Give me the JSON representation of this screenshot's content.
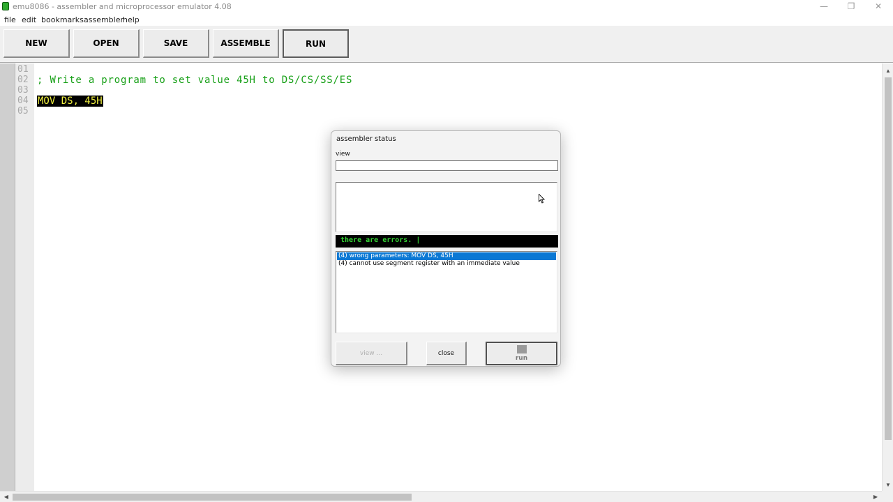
{
  "window": {
    "title": "emu8086 - assembler and microprocessor emulator 4.08",
    "controls": {
      "minimize": "—",
      "maximize": "❐",
      "close": "✕"
    }
  },
  "menu": [
    "file",
    "edit",
    "bookmarks",
    "assembler",
    "help"
  ],
  "toolbar": [
    "NEW",
    "OPEN",
    "SAVE",
    "ASSEMBLE",
    "RUN"
  ],
  "editor": {
    "line_numbers": [
      "01",
      "02",
      "03",
      "04",
      "05"
    ],
    "lines": [
      "",
      "; Write a program to set value 45H to DS/CS/SS/ES",
      "",
      "MOV DS, 45H",
      ""
    ],
    "selected_line": 4
  },
  "dialog": {
    "title": "assembler status",
    "view_label": "view",
    "status_text": "there are errors. |",
    "errors": [
      "(4) wrong parameters: MOV  DS, 45H",
      "(4) cannot use segment register with an immediate value"
    ],
    "selected_error": 1,
    "buttons": {
      "view": "view ...",
      "close": "close",
      "run": "run"
    }
  },
  "colors": {
    "comment": "#17a017",
    "status_bg": "#000000",
    "status_text": "#33d433",
    "selection": "#0a78d4"
  },
  "icons": {
    "app": "emu8086-icon",
    "cursor": "mouse-pointer-icon"
  }
}
